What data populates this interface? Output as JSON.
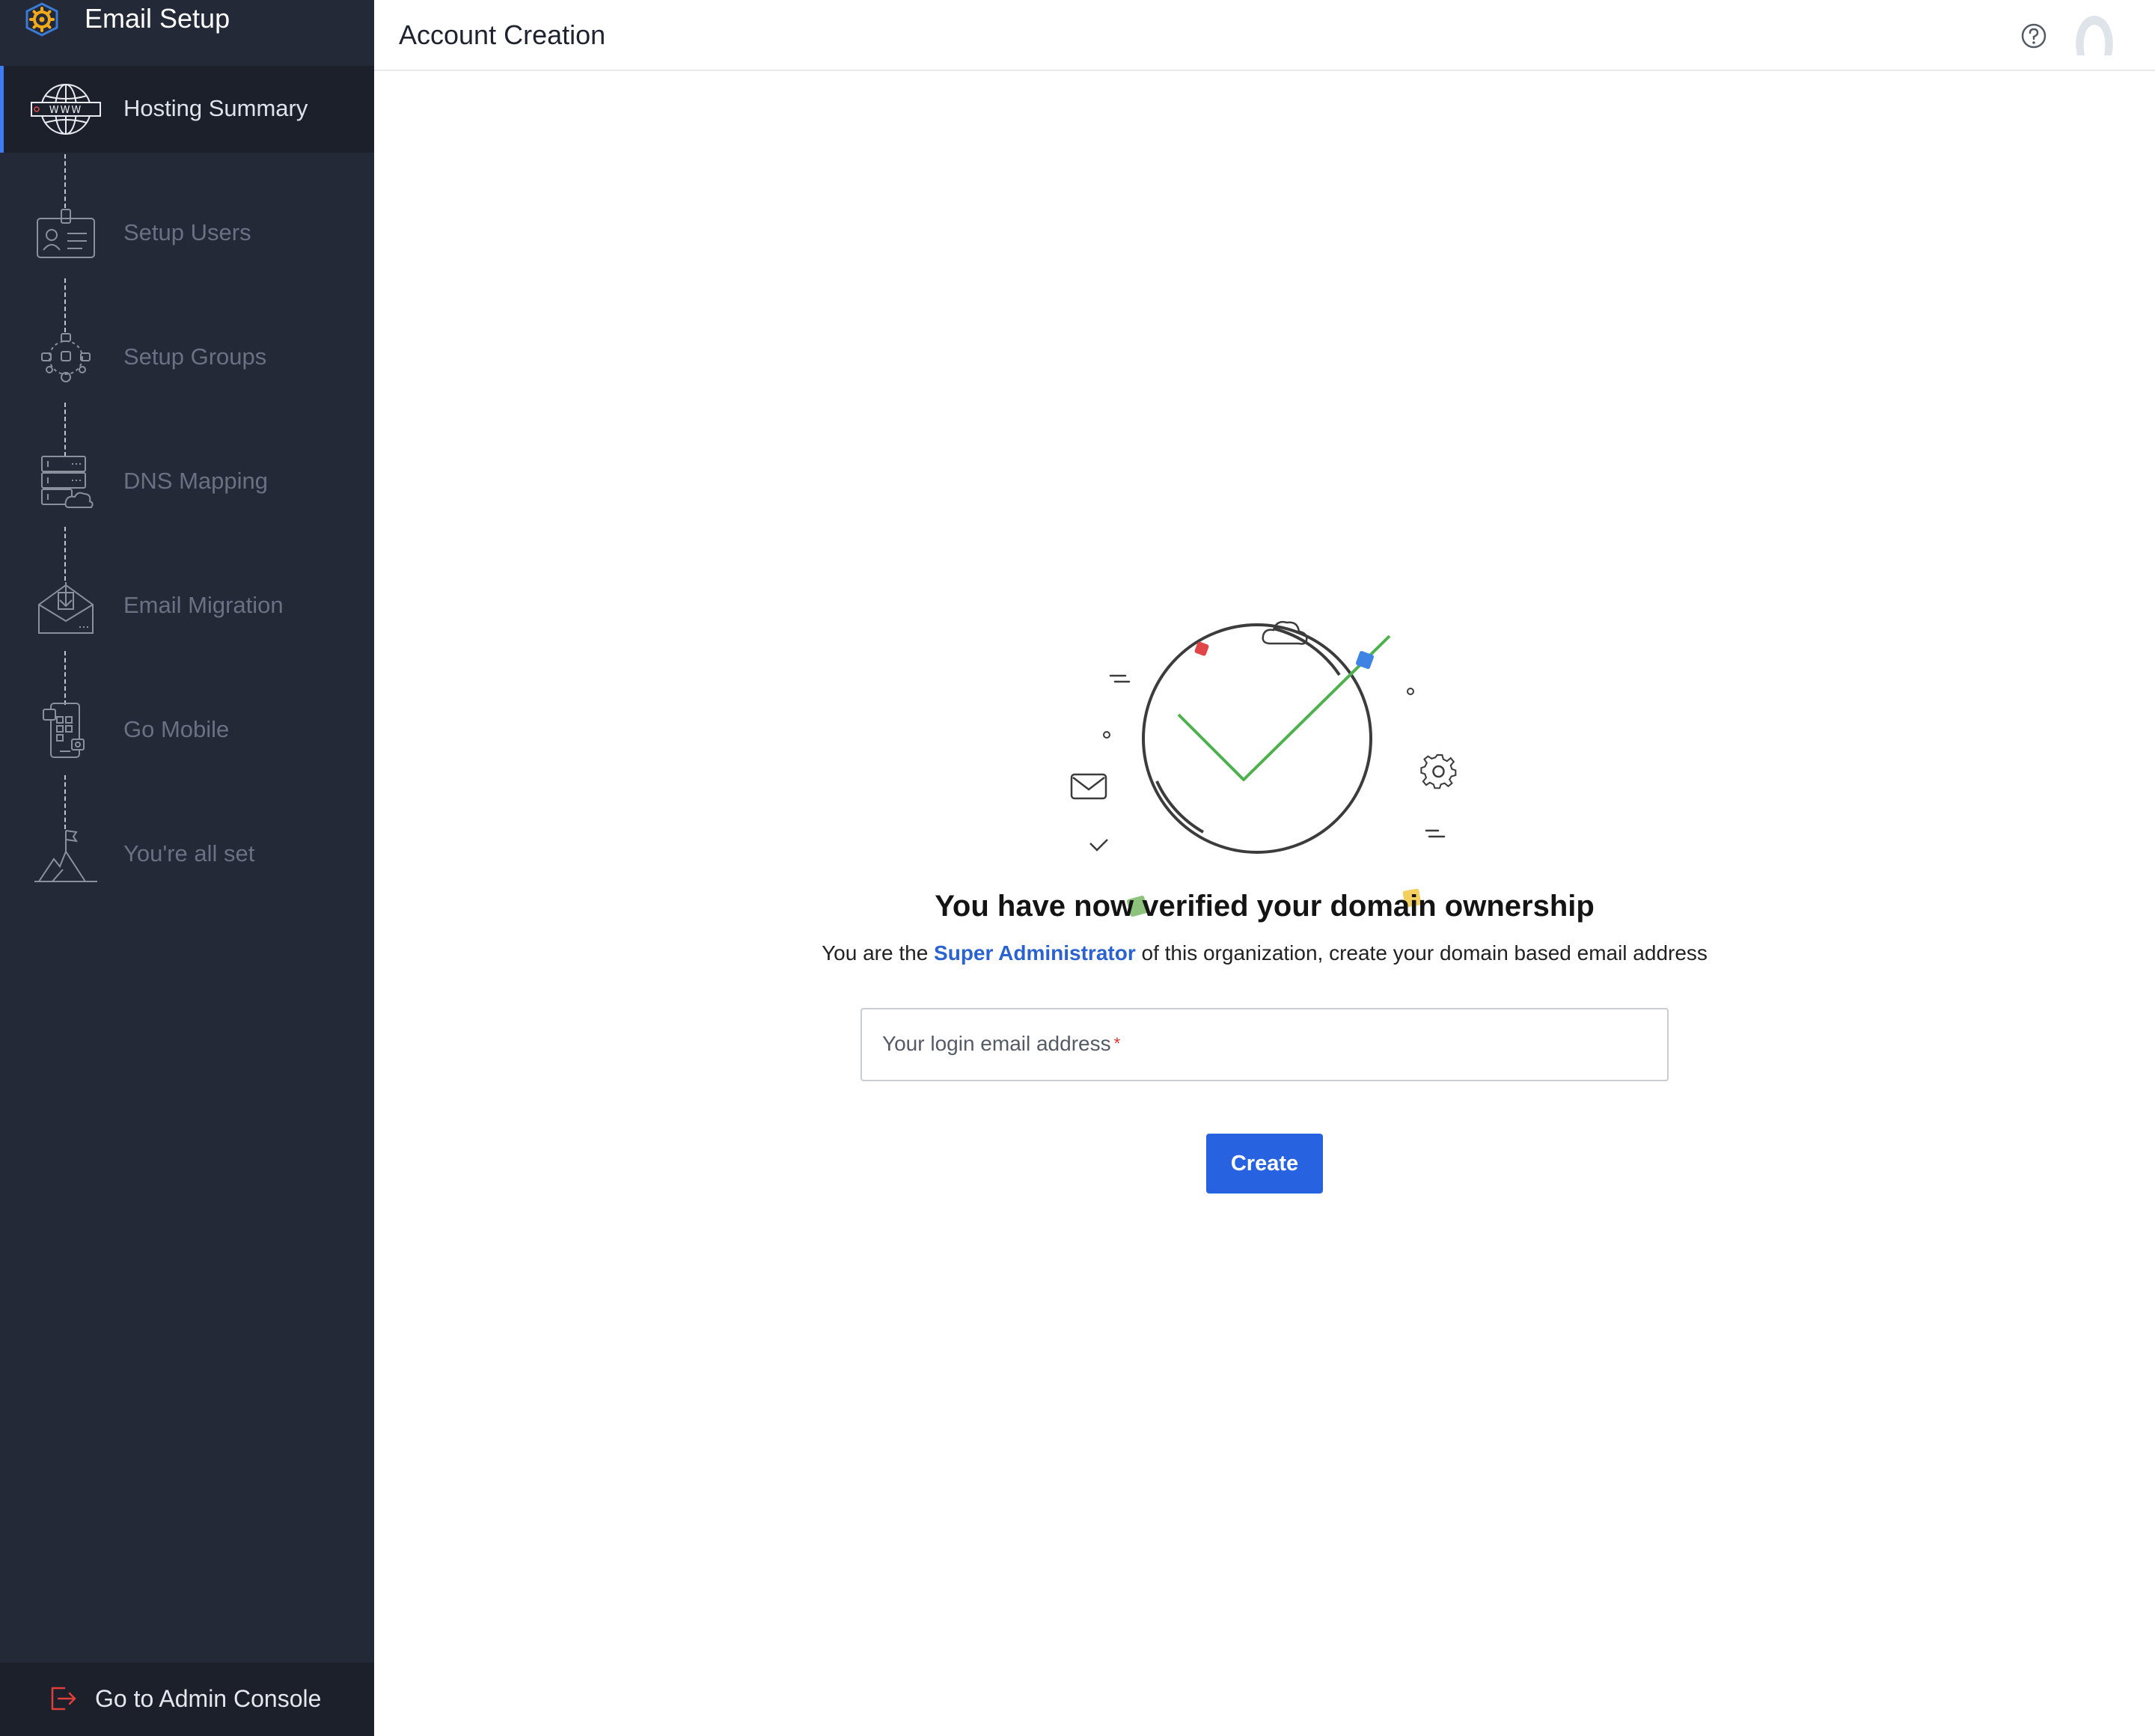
{
  "app": {
    "title": "Email Setup",
    "brand_icon": "gear-badge-icon"
  },
  "sidebar": {
    "steps": [
      {
        "label": "Hosting Summary",
        "icon": "globe-www-icon",
        "active": true
      },
      {
        "label": "Setup Users",
        "icon": "user-id-card-icon",
        "active": false
      },
      {
        "label": "Setup Groups",
        "icon": "group-network-icon",
        "active": false
      },
      {
        "label": "DNS Mapping",
        "icon": "server-cloud-icon",
        "active": false
      },
      {
        "label": "Email Migration",
        "icon": "envelope-download-icon",
        "active": false
      },
      {
        "label": "Go Mobile",
        "icon": "mobile-apps-icon",
        "active": false
      },
      {
        "label": "You're all set",
        "icon": "mountain-flag-icon",
        "active": false
      }
    ],
    "footer": {
      "label": "Go to Admin Console",
      "icon": "exit-icon"
    }
  },
  "header": {
    "title": "Account Creation",
    "help_icon": "help-icon",
    "avatar_icon": "user-avatar-icon"
  },
  "main": {
    "illustration_icon": "success-check-icon",
    "headline": "You have now verified your domain ownership",
    "subtext_prefix": "You are the ",
    "subtext_link": "Super Administrator",
    "subtext_suffix": " of this organization, create your domain based email address",
    "email_field": {
      "label": "Your login email address",
      "required_mark": "*",
      "value": ""
    },
    "create_label": "Create"
  },
  "colors": {
    "sidebar_bg": "#232936",
    "accent": "#2763e0",
    "link": "#2a62cf",
    "success": "#4fb04e",
    "required": "#d9312c"
  }
}
